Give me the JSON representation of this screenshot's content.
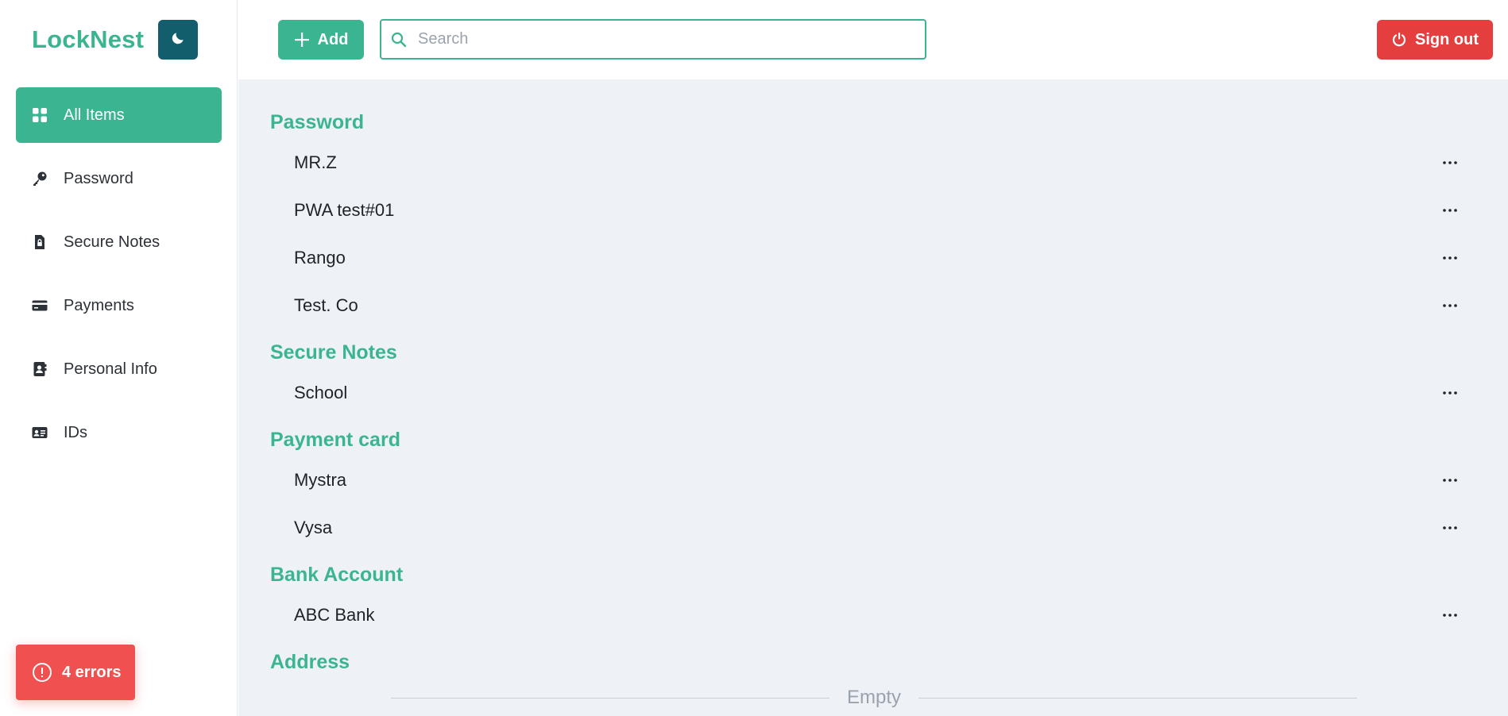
{
  "app": {
    "brand": "LockNest"
  },
  "sidebar": {
    "items": [
      {
        "label": "All Items",
        "icon": "grid-icon",
        "active": true
      },
      {
        "label": "Password",
        "icon": "key-icon"
      },
      {
        "label": "Secure Notes",
        "icon": "note-lock-icon"
      },
      {
        "label": "Payments",
        "icon": "credit-card-icon"
      },
      {
        "label": "Personal Info",
        "icon": "contact-book-icon"
      },
      {
        "label": "IDs",
        "icon": "id-card-icon"
      }
    ],
    "errors_label": "4 errors"
  },
  "toolbar": {
    "add_label": "Add",
    "search_placeholder": "Search",
    "search_value": "",
    "signout_label": "Sign out"
  },
  "sections": [
    {
      "title": "Password",
      "items": [
        "MR.Z",
        "PWA test#01",
        "Rango",
        "Test. Co"
      ]
    },
    {
      "title": "Secure Notes",
      "items": [
        "School"
      ]
    },
    {
      "title": "Payment card",
      "items": [
        "Mystra",
        "Vysa"
      ]
    },
    {
      "title": "Bank Account",
      "items": [
        "ABC Bank"
      ]
    },
    {
      "title": "Address",
      "items": [],
      "empty_label": "Empty"
    }
  ],
  "colors": {
    "accent": "#3bb591",
    "theme_button": "#135e6c",
    "danger": "#e53e3e",
    "errors_badge": "#f0504f",
    "main_bg": "#eef2f6"
  }
}
